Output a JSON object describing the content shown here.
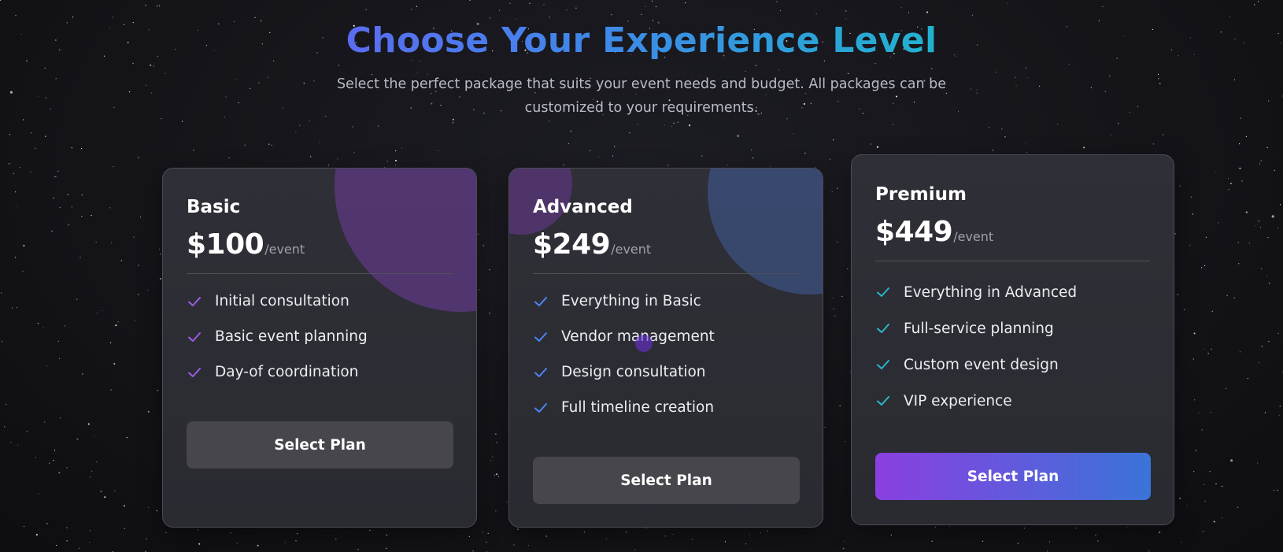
{
  "header": {
    "title": "Choose Your Experience Level",
    "subtitle": "Select the perfect package that suits your event needs and budget. All packages can be customized to your requirements."
  },
  "colors": {
    "title_gradient": [
      "#5b6cf0",
      "#3d8ae8",
      "#22b2cf"
    ],
    "basic_check": "#9b5de5",
    "advanced_check": "#4d86f0",
    "premium_check": "#2bb6c8",
    "premium_button_gradient": [
      "#8a3fe0",
      "#3a74d8"
    ]
  },
  "plans": [
    {
      "name": "Basic",
      "price": "$100",
      "period": "/event",
      "features": [
        "Initial consultation",
        "Basic event planning",
        "Day-of coordination"
      ],
      "button_label": "Select Plan",
      "check_icon": "check-icon"
    },
    {
      "name": "Advanced",
      "price": "$249",
      "period": "/event",
      "features": [
        "Everything in Basic",
        "Vendor management",
        "Design consultation",
        "Full timeline creation"
      ],
      "button_label": "Select Plan",
      "check_icon": "check-icon"
    },
    {
      "name": "Premium",
      "price": "$449",
      "period": "/event",
      "features": [
        "Everything in Advanced",
        "Full-service planning",
        "Custom event design",
        "VIP experience"
      ],
      "button_label": "Select Plan",
      "check_icon": "check-icon"
    }
  ]
}
